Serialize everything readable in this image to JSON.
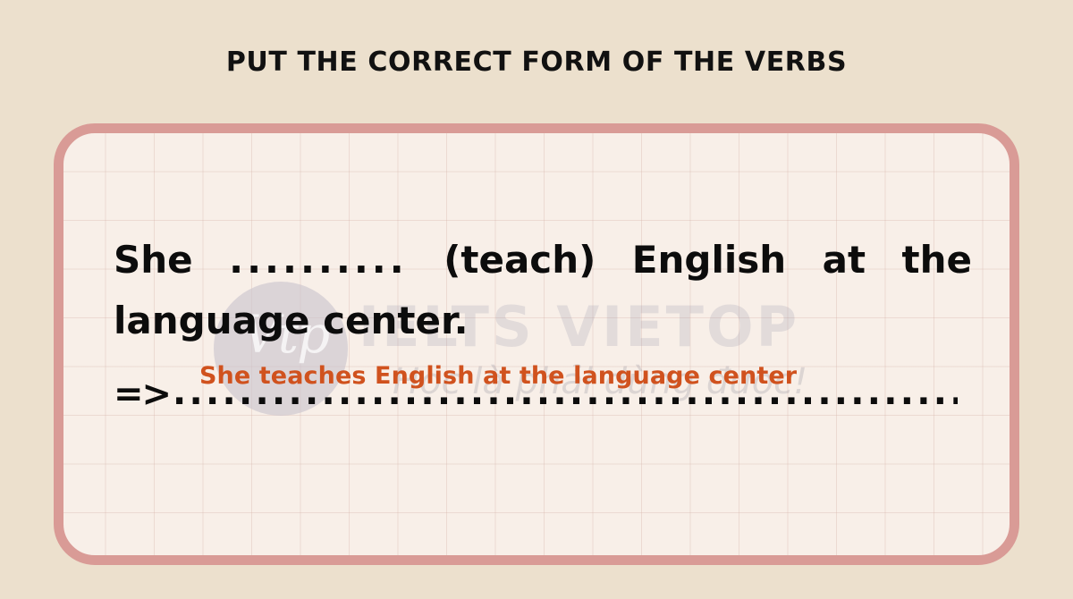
{
  "page": {
    "title": "PUT THE CORRECT FORM OF THE VERBS",
    "background_color": "#ece0cd"
  },
  "card": {
    "border_color": "#d99b96",
    "fill_color": "#f8efe8",
    "grid_color": "#d0aaa0"
  },
  "exercise": {
    "question_prefix": "She",
    "blank": "..........",
    "verb_cue": "(teach)",
    "question_rest": "English at the language center.",
    "question_full": "She .......... (teach) English at the language center.",
    "arrow": "=>",
    "answer_line_dots": "......................................................................",
    "answer_text": "She teaches English at the language center",
    "answer_color": "#d0521e"
  },
  "watermark": {
    "brand": "IELTS VIETOP",
    "tagline": "Học là phải dùng được!",
    "logo_script": "Vtp",
    "brand_color": "#8c8ca5",
    "circle_color": "#c9c4cd"
  }
}
